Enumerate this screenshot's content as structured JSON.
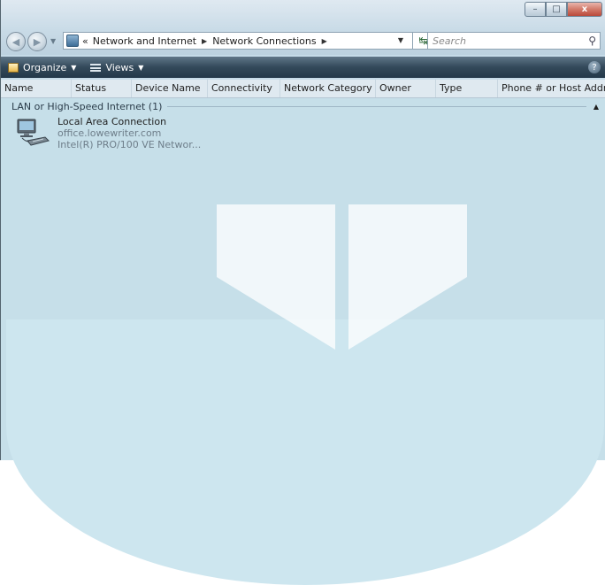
{
  "window": {
    "caption_buttons": {
      "minimize": "–",
      "maximize": "□",
      "close": "x"
    }
  },
  "navigation": {
    "back_icon": "back-arrow-icon",
    "forward_icon": "forward-arrow-icon",
    "address_prefix": "«",
    "breadcrumbs": [
      "Network and Internet",
      "Network Connections"
    ],
    "search_placeholder": "Search"
  },
  "toolbar": {
    "organize_label": "Organize",
    "views_label": "Views",
    "help_label": "?"
  },
  "columns": [
    "Name",
    "Status",
    "Device Name",
    "Connectivity",
    "Network Category",
    "Owner",
    "Type",
    "Phone # or Host Addre..."
  ],
  "groups": [
    {
      "title": "LAN or High-Speed Internet (1)",
      "items": [
        {
          "name": "Local Area Connection",
          "line2": "office.lowewriter.com",
          "line3": "Intel(R) PRO/100 VE Networ...",
          "icon": "network-connection-icon"
        }
      ]
    }
  ],
  "colors": {
    "content_bg": "#c6dfe9",
    "toolbar_bg": "#33495a"
  }
}
